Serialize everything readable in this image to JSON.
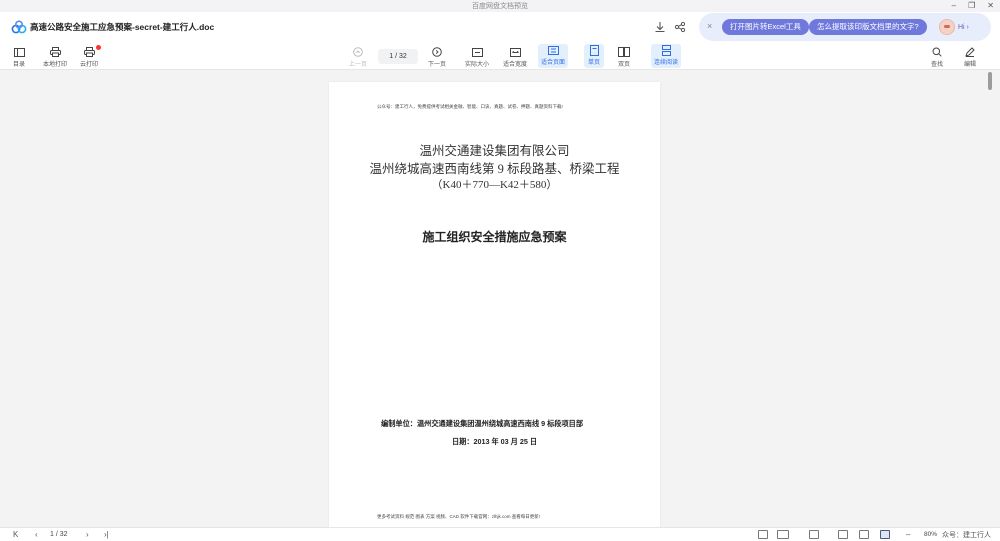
{
  "window": {
    "title": "百度网盘文档预览",
    "controls": [
      "–",
      "❐",
      "✕"
    ]
  },
  "header": {
    "doc_title": "高速公路安全施工应急预案-secret-建工行人.doc",
    "download_icon": "download-icon",
    "share_icon": "share-icon"
  },
  "ai_bar": {
    "close": "×",
    "chip_excel": "打开图片转Excel工具",
    "chip_extract": "怎么提取该印版文档里的文字?",
    "hi": "Hi ›"
  },
  "toolbar": {
    "toc": "目录",
    "local_print": "本地打印",
    "cloud_print": "云打印",
    "prev_page": "上一页",
    "page_indicator": "1 / 32",
    "next_page": "下一页",
    "actual_size": "实际大小",
    "fit_width": "适合宽度",
    "fit_page": "适合页面",
    "single_page": "单页",
    "double_page": "双页",
    "continuous": "连续阅读",
    "search": "查找",
    "edit": "编辑"
  },
  "page": {
    "header_text": "公众号：建工行人，免费提供考试相关金融、智能、口诀、真题、试卷、押题、真题资料下载!",
    "company": "温州交通建设集团有限公司",
    "project": "温州绕城高速西南线第 9 标段路基、桥梁工程",
    "range": "（K40＋770—K42＋580）",
    "plan_title": "施工组织安全措施应急预案",
    "unit": "编制单位：温州交通建设集团温州绕城高速西南线 9 标段项目部",
    "date": "日期：2013 年 03 月 25 日",
    "footer_text": "更多考试资料 规范 图表 方案 视频、CAD 软件下载官网：zlhjk.com 查看每日更新!"
  },
  "statusbar": {
    "first": "K",
    "prev": "‹",
    "page_indicator": "1 / 32",
    "next": "›",
    "last": "›|",
    "zoom_out": "–",
    "zoom": "80%",
    "zoom_in": "+",
    "watermark": "众号：建工行人"
  }
}
